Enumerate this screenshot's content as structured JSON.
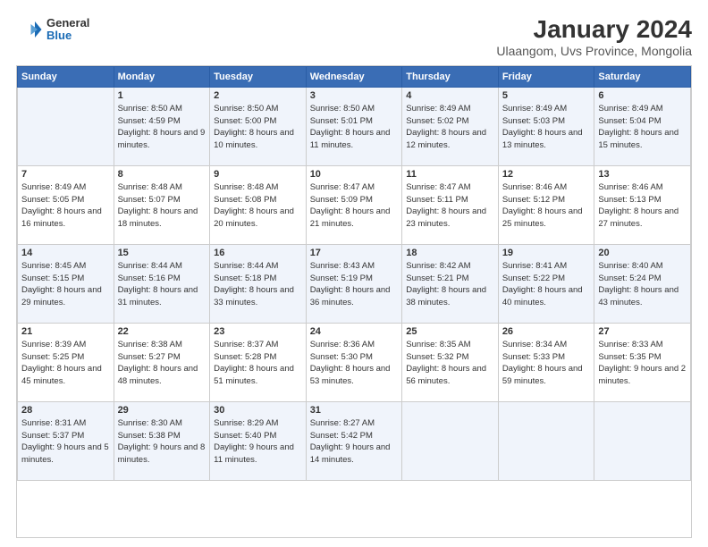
{
  "header": {
    "logo_line1": "General",
    "logo_line2": "Blue",
    "title": "January 2024",
    "subtitle": "Ulaangom, Uvs Province, Mongolia"
  },
  "calendar": {
    "headers": [
      "Sunday",
      "Monday",
      "Tuesday",
      "Wednesday",
      "Thursday",
      "Friday",
      "Saturday"
    ],
    "weeks": [
      [
        {
          "day": "",
          "sunrise": "",
          "sunset": "",
          "daylight": ""
        },
        {
          "day": "1",
          "sunrise": "Sunrise: 8:50 AM",
          "sunset": "Sunset: 4:59 PM",
          "daylight": "Daylight: 8 hours and 9 minutes."
        },
        {
          "day": "2",
          "sunrise": "Sunrise: 8:50 AM",
          "sunset": "Sunset: 5:00 PM",
          "daylight": "Daylight: 8 hours and 10 minutes."
        },
        {
          "day": "3",
          "sunrise": "Sunrise: 8:50 AM",
          "sunset": "Sunset: 5:01 PM",
          "daylight": "Daylight: 8 hours and 11 minutes."
        },
        {
          "day": "4",
          "sunrise": "Sunrise: 8:49 AM",
          "sunset": "Sunset: 5:02 PM",
          "daylight": "Daylight: 8 hours and 12 minutes."
        },
        {
          "day": "5",
          "sunrise": "Sunrise: 8:49 AM",
          "sunset": "Sunset: 5:03 PM",
          "daylight": "Daylight: 8 hours and 13 minutes."
        },
        {
          "day": "6",
          "sunrise": "Sunrise: 8:49 AM",
          "sunset": "Sunset: 5:04 PM",
          "daylight": "Daylight: 8 hours and 15 minutes."
        }
      ],
      [
        {
          "day": "7",
          "sunrise": "Sunrise: 8:49 AM",
          "sunset": "Sunset: 5:05 PM",
          "daylight": "Daylight: 8 hours and 16 minutes."
        },
        {
          "day": "8",
          "sunrise": "Sunrise: 8:48 AM",
          "sunset": "Sunset: 5:07 PM",
          "daylight": "Daylight: 8 hours and 18 minutes."
        },
        {
          "day": "9",
          "sunrise": "Sunrise: 8:48 AM",
          "sunset": "Sunset: 5:08 PM",
          "daylight": "Daylight: 8 hours and 20 minutes."
        },
        {
          "day": "10",
          "sunrise": "Sunrise: 8:47 AM",
          "sunset": "Sunset: 5:09 PM",
          "daylight": "Daylight: 8 hours and 21 minutes."
        },
        {
          "day": "11",
          "sunrise": "Sunrise: 8:47 AM",
          "sunset": "Sunset: 5:11 PM",
          "daylight": "Daylight: 8 hours and 23 minutes."
        },
        {
          "day": "12",
          "sunrise": "Sunrise: 8:46 AM",
          "sunset": "Sunset: 5:12 PM",
          "daylight": "Daylight: 8 hours and 25 minutes."
        },
        {
          "day": "13",
          "sunrise": "Sunrise: 8:46 AM",
          "sunset": "Sunset: 5:13 PM",
          "daylight": "Daylight: 8 hours and 27 minutes."
        }
      ],
      [
        {
          "day": "14",
          "sunrise": "Sunrise: 8:45 AM",
          "sunset": "Sunset: 5:15 PM",
          "daylight": "Daylight: 8 hours and 29 minutes."
        },
        {
          "day": "15",
          "sunrise": "Sunrise: 8:44 AM",
          "sunset": "Sunset: 5:16 PM",
          "daylight": "Daylight: 8 hours and 31 minutes."
        },
        {
          "day": "16",
          "sunrise": "Sunrise: 8:44 AM",
          "sunset": "Sunset: 5:18 PM",
          "daylight": "Daylight: 8 hours and 33 minutes."
        },
        {
          "day": "17",
          "sunrise": "Sunrise: 8:43 AM",
          "sunset": "Sunset: 5:19 PM",
          "daylight": "Daylight: 8 hours and 36 minutes."
        },
        {
          "day": "18",
          "sunrise": "Sunrise: 8:42 AM",
          "sunset": "Sunset: 5:21 PM",
          "daylight": "Daylight: 8 hours and 38 minutes."
        },
        {
          "day": "19",
          "sunrise": "Sunrise: 8:41 AM",
          "sunset": "Sunset: 5:22 PM",
          "daylight": "Daylight: 8 hours and 40 minutes."
        },
        {
          "day": "20",
          "sunrise": "Sunrise: 8:40 AM",
          "sunset": "Sunset: 5:24 PM",
          "daylight": "Daylight: 8 hours and 43 minutes."
        }
      ],
      [
        {
          "day": "21",
          "sunrise": "Sunrise: 8:39 AM",
          "sunset": "Sunset: 5:25 PM",
          "daylight": "Daylight: 8 hours and 45 minutes."
        },
        {
          "day": "22",
          "sunrise": "Sunrise: 8:38 AM",
          "sunset": "Sunset: 5:27 PM",
          "daylight": "Daylight: 8 hours and 48 minutes."
        },
        {
          "day": "23",
          "sunrise": "Sunrise: 8:37 AM",
          "sunset": "Sunset: 5:28 PM",
          "daylight": "Daylight: 8 hours and 51 minutes."
        },
        {
          "day": "24",
          "sunrise": "Sunrise: 8:36 AM",
          "sunset": "Sunset: 5:30 PM",
          "daylight": "Daylight: 8 hours and 53 minutes."
        },
        {
          "day": "25",
          "sunrise": "Sunrise: 8:35 AM",
          "sunset": "Sunset: 5:32 PM",
          "daylight": "Daylight: 8 hours and 56 minutes."
        },
        {
          "day": "26",
          "sunrise": "Sunrise: 8:34 AM",
          "sunset": "Sunset: 5:33 PM",
          "daylight": "Daylight: 8 hours and 59 minutes."
        },
        {
          "day": "27",
          "sunrise": "Sunrise: 8:33 AM",
          "sunset": "Sunset: 5:35 PM",
          "daylight": "Daylight: 9 hours and 2 minutes."
        }
      ],
      [
        {
          "day": "28",
          "sunrise": "Sunrise: 8:31 AM",
          "sunset": "Sunset: 5:37 PM",
          "daylight": "Daylight: 9 hours and 5 minutes."
        },
        {
          "day": "29",
          "sunrise": "Sunrise: 8:30 AM",
          "sunset": "Sunset: 5:38 PM",
          "daylight": "Daylight: 9 hours and 8 minutes."
        },
        {
          "day": "30",
          "sunrise": "Sunrise: 8:29 AM",
          "sunset": "Sunset: 5:40 PM",
          "daylight": "Daylight: 9 hours and 11 minutes."
        },
        {
          "day": "31",
          "sunrise": "Sunrise: 8:27 AM",
          "sunset": "Sunset: 5:42 PM",
          "daylight": "Daylight: 9 hours and 14 minutes."
        },
        {
          "day": "",
          "sunrise": "",
          "sunset": "",
          "daylight": ""
        },
        {
          "day": "",
          "sunrise": "",
          "sunset": "",
          "daylight": ""
        },
        {
          "day": "",
          "sunrise": "",
          "sunset": "",
          "daylight": ""
        }
      ]
    ]
  }
}
